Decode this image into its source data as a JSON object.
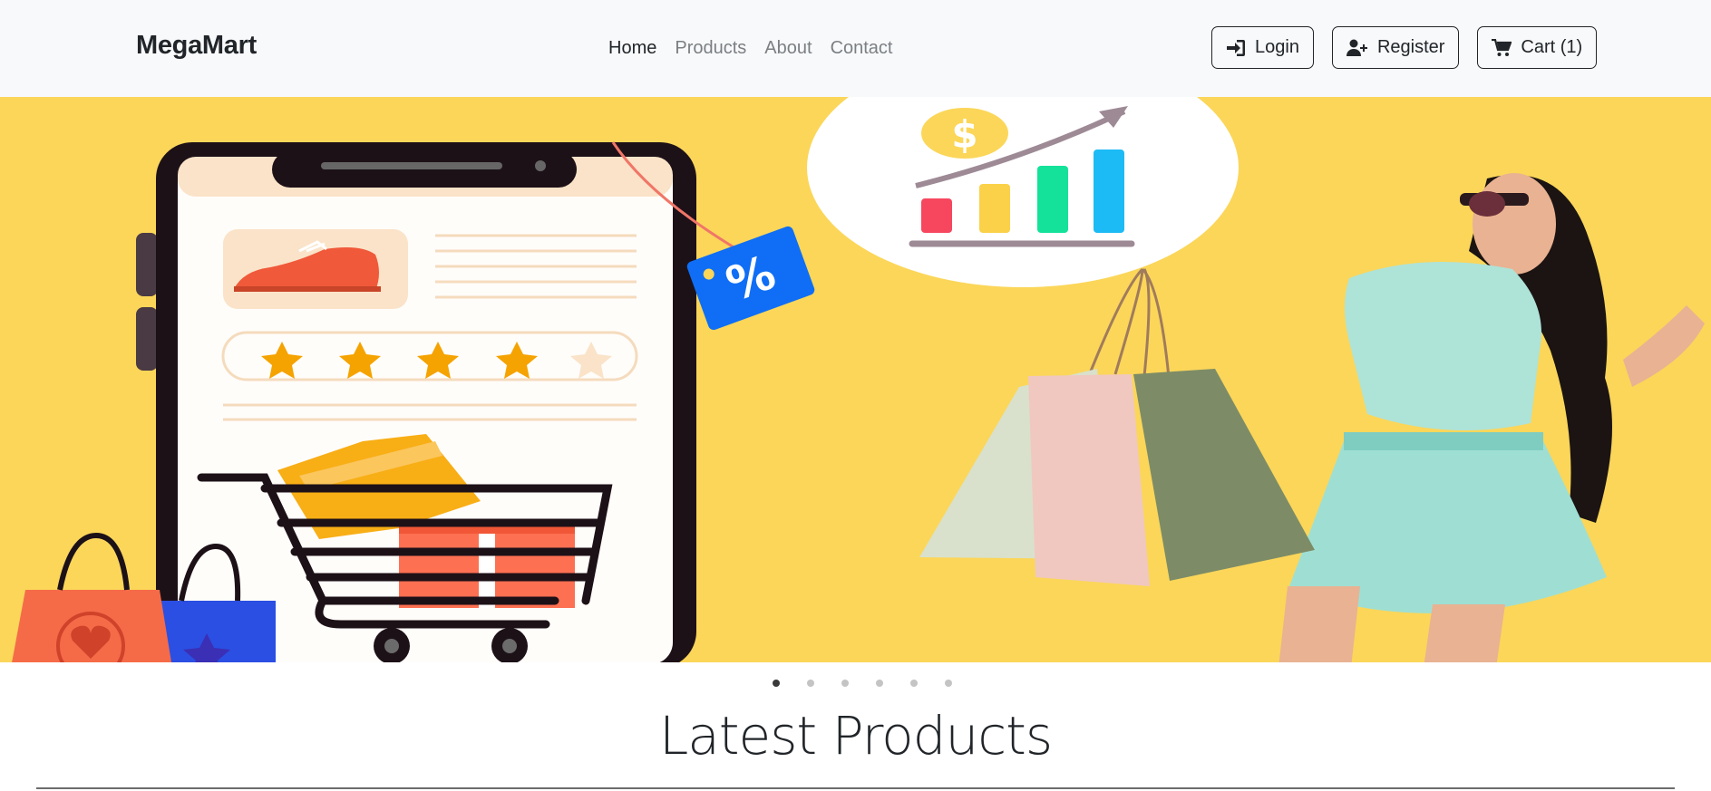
{
  "navbar": {
    "brand": "MegaMart",
    "links": [
      {
        "label": "Home",
        "active": true
      },
      {
        "label": "Products",
        "active": false
      },
      {
        "label": "About",
        "active": false
      },
      {
        "label": "Contact",
        "active": false
      }
    ],
    "buttons": {
      "login": "Login",
      "register": "Register",
      "cart": "Cart (1)"
    }
  },
  "hero": {
    "background_color": "#fbd659",
    "discount_tag": "%",
    "currency_symbol": "$",
    "slide_count": 6,
    "active_slide": 1
  },
  "section": {
    "title": "Latest Products"
  },
  "icons": {
    "login": "sign-in-icon",
    "register": "user-plus-icon",
    "cart": "shopping-cart-icon"
  }
}
